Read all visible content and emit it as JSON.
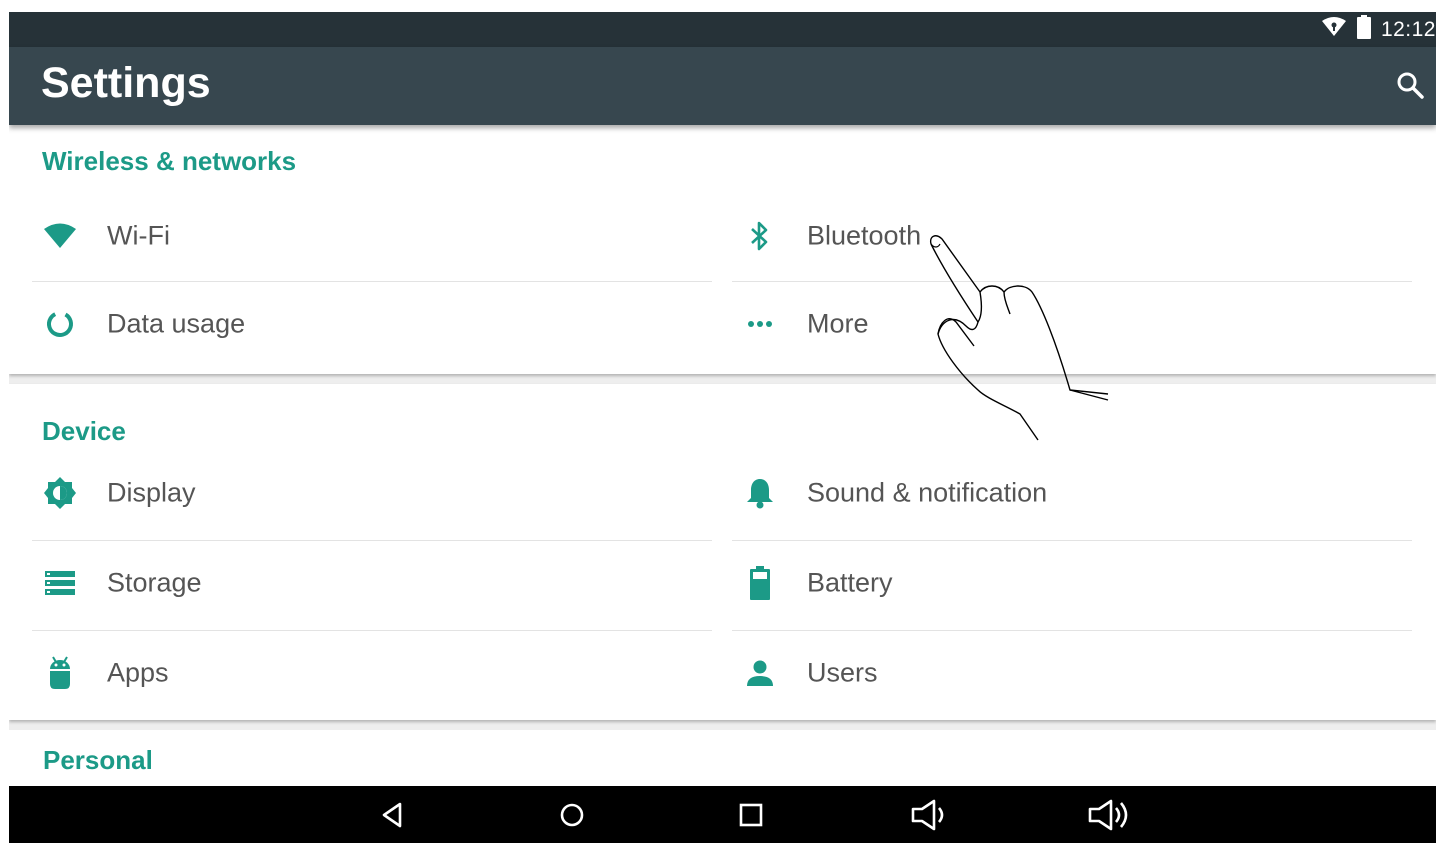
{
  "status_bar": {
    "time": "12:12",
    "icons": [
      "wifi-icon",
      "battery-icon"
    ]
  },
  "app_bar": {
    "title": "Settings",
    "search_icon": "search-icon"
  },
  "sections": {
    "wireless": {
      "title": "Wireless & networks",
      "items": [
        {
          "label": "Wi‑Fi",
          "icon": "wifi-icon"
        },
        {
          "label": "Bluetooth",
          "icon": "bluetooth-icon"
        },
        {
          "label": "Data usage",
          "icon": "data-usage-icon"
        },
        {
          "label": "More",
          "icon": "more-icon"
        }
      ]
    },
    "device": {
      "title": "Device",
      "items": [
        {
          "label": "Display",
          "icon": "brightness-icon"
        },
        {
          "label": "Sound & notification",
          "icon": "bell-icon"
        },
        {
          "label": "Storage",
          "icon": "storage-icon"
        },
        {
          "label": "Battery",
          "icon": "battery-icon"
        },
        {
          "label": "Apps",
          "icon": "android-icon"
        },
        {
          "label": "Users",
          "icon": "person-icon"
        }
      ]
    },
    "personal": {
      "title": "Personal"
    }
  },
  "nav_bar": [
    "back-icon",
    "home-icon",
    "recents-icon",
    "volume-down-icon",
    "volume-up-icon"
  ],
  "colors": {
    "accent": "#1c9a87",
    "app_bar": "#37474f",
    "status_bar": "#263238",
    "nav_bar": "#000000"
  }
}
